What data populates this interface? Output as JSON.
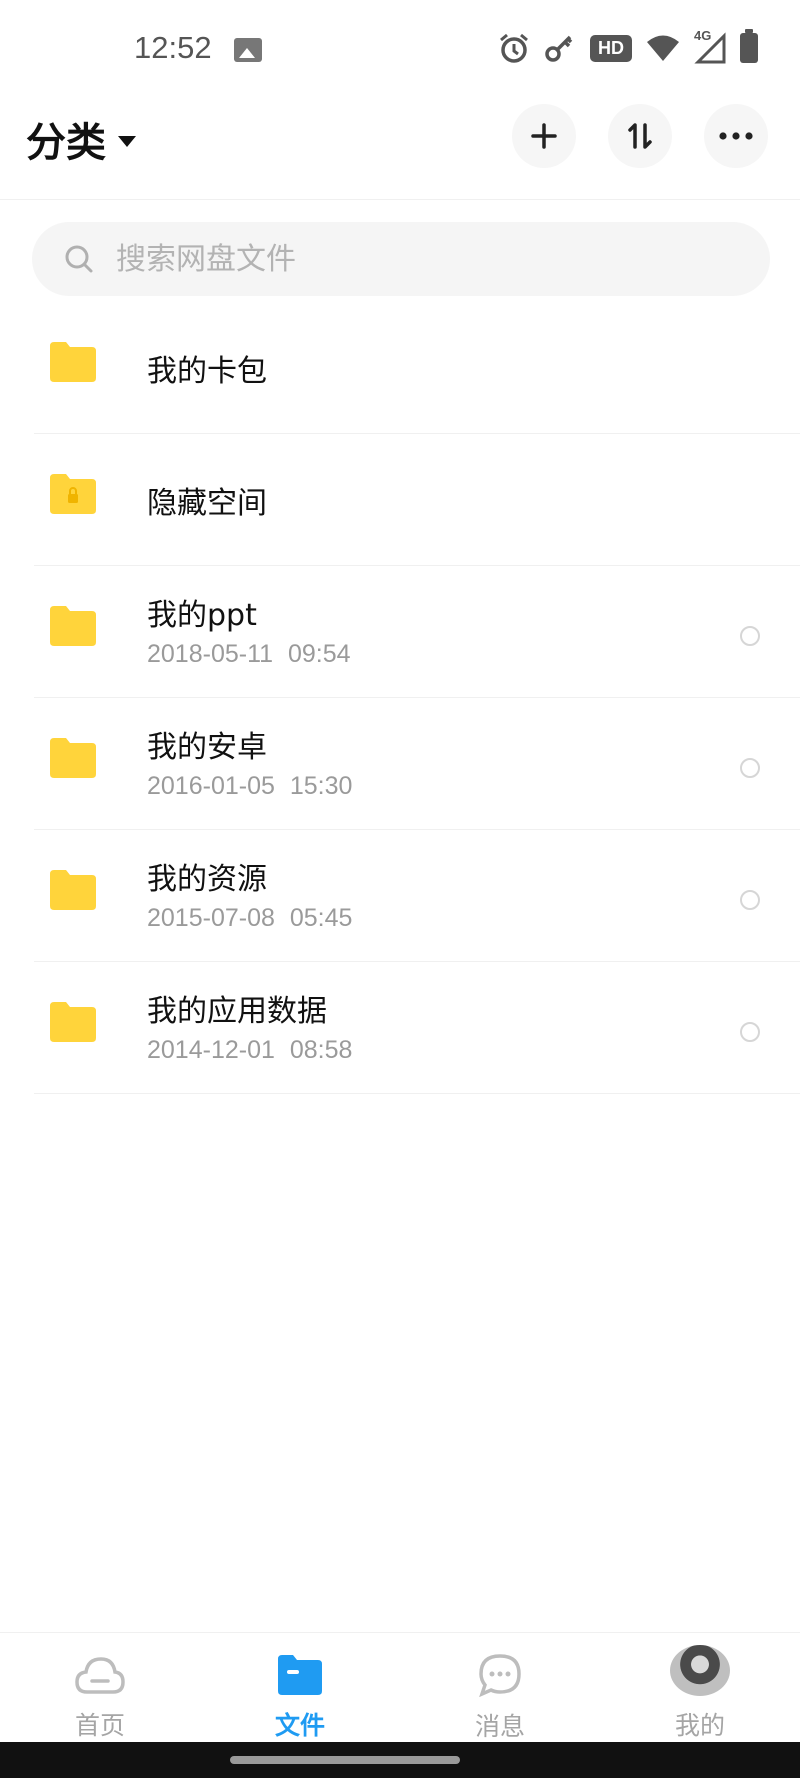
{
  "status_bar": {
    "time": "12:52",
    "hd_label": "HD",
    "network_label": "4G"
  },
  "header": {
    "title": "分类"
  },
  "search": {
    "placeholder": "搜索网盘文件"
  },
  "files": [
    {
      "name": "我的卡包",
      "date": "",
      "icon": "folder-icon",
      "selectable": false
    },
    {
      "name": "隐藏空间",
      "date": "",
      "icon": "lock-folder-icon",
      "selectable": false
    },
    {
      "name": "我的ppt",
      "date": "2018-05-11 09:54",
      "icon": "folder-icon",
      "selectable": true
    },
    {
      "name": "我的安卓",
      "date": "2016-01-05 15:30",
      "icon": "folder-icon",
      "selectable": true
    },
    {
      "name": "我的资源",
      "date": "2015-07-08 05:45",
      "icon": "folder-icon",
      "selectable": true
    },
    {
      "name": "我的应用数据",
      "date": "2014-12-01 08:58",
      "icon": "folder-icon",
      "selectable": true
    }
  ],
  "bottom_nav": {
    "items": [
      {
        "label": "首页",
        "icon": "cloud-icon",
        "active": false
      },
      {
        "label": "文件",
        "icon": "file-folder-icon",
        "active": true
      },
      {
        "label": "消息",
        "icon": "chat-icon",
        "active": false
      },
      {
        "label": "我的",
        "icon": "avatar",
        "active": false
      }
    ]
  },
  "colors": {
    "accent": "#1f9bf2",
    "folder": "#ffd43b"
  }
}
